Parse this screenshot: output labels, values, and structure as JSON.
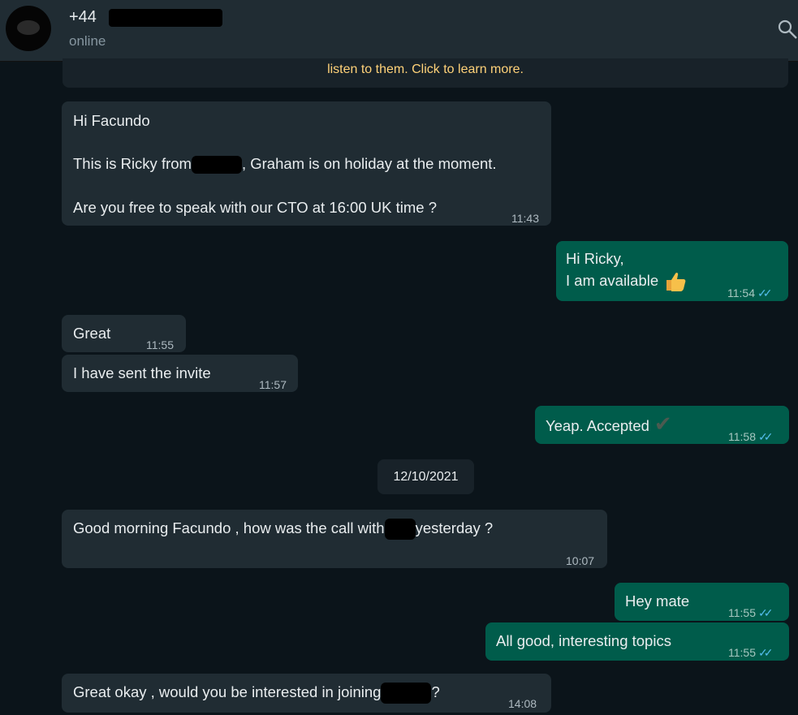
{
  "header": {
    "phone_prefix": "+44",
    "status": "online"
  },
  "banner": {
    "text": "listen to them. Click to learn more."
  },
  "messages": [
    {
      "lines": [
        "Hi Facundo",
        "This is Ricky from",
        ", Graham is on holiday at the moment.",
        "Are you free to speak with our CTO at 16:00 UK time ?"
      ],
      "time": "11:43"
    },
    {
      "lines": [
        "Hi Ricky,",
        "I am available"
      ],
      "time": "11:54"
    },
    {
      "text": "Great",
      "time": "11:55"
    },
    {
      "text": "I have sent the invite",
      "time": "11:57"
    },
    {
      "text": "Yeap.  Accepted",
      "time": "11:58"
    },
    {
      "text_before": "Good morning Facundo , how was the call with",
      "text_after": "yesterday ?",
      "time": "10:07"
    },
    {
      "text": "Hey mate",
      "time": "11:55"
    },
    {
      "text": "All good, interesting topics",
      "time": "11:55"
    },
    {
      "text_before": "Great okay , would you be interested in joining",
      "text_after": "?",
      "time": "14:08"
    }
  ],
  "date_divider": "12/10/2021",
  "icons": {
    "search": "search-icon",
    "double_tick": "double-check-icon",
    "thumbs_up": "thumbs-up-icon",
    "check": "check-mark-icon"
  },
  "colors": {
    "background": "#0b141a",
    "incoming_bubble": "#202c33",
    "outgoing_bubble": "#005c4b",
    "read_ticks": "#53bdeb",
    "banner_text": "#ffd279"
  }
}
